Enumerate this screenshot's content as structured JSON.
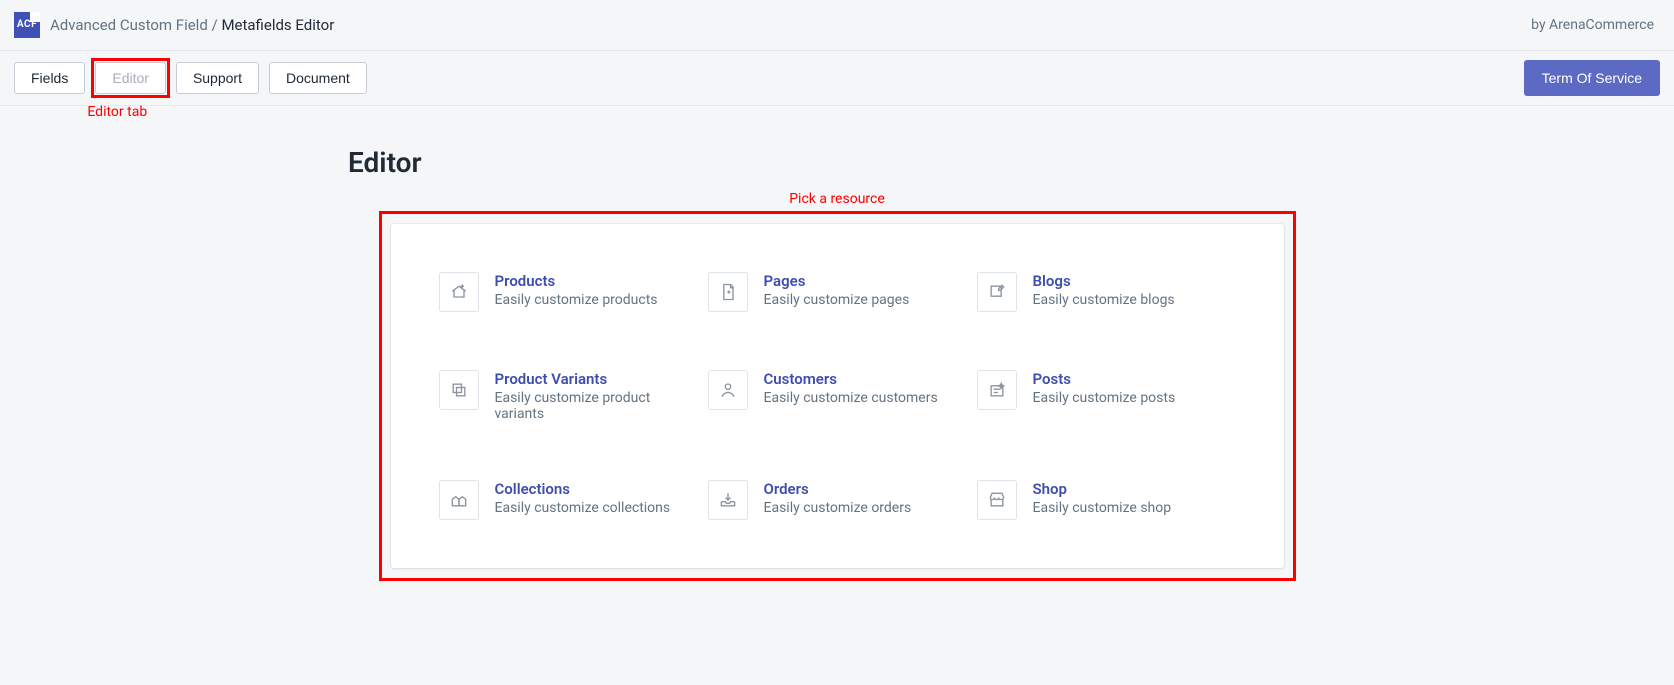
{
  "header": {
    "app_name": "Advanced Custom Field",
    "separator": " / ",
    "section": "Metafields Editor",
    "byline": "by ArenaCommerce"
  },
  "tabs": {
    "fields": "Fields",
    "editor": "Editor",
    "support": "Support",
    "document": "Document",
    "term_of_service": "Term Of Service"
  },
  "annotations": {
    "editor_tab": "Editor tab",
    "pick_resource": "Pick a resource"
  },
  "page": {
    "title": "Editor"
  },
  "resources": [
    {
      "title": "Products",
      "sub": "Easily customize products"
    },
    {
      "title": "Pages",
      "sub": "Easily customize pages"
    },
    {
      "title": "Blogs",
      "sub": "Easily customize blogs"
    },
    {
      "title": "Product Variants",
      "sub": "Easily customize product variants"
    },
    {
      "title": "Customers",
      "sub": "Easily customize customers"
    },
    {
      "title": "Posts",
      "sub": "Easily customize posts"
    },
    {
      "title": "Collections",
      "sub": "Easily customize collections"
    },
    {
      "title": "Orders",
      "sub": "Easily customize orders"
    },
    {
      "title": "Shop",
      "sub": "Easily customize shop"
    }
  ]
}
